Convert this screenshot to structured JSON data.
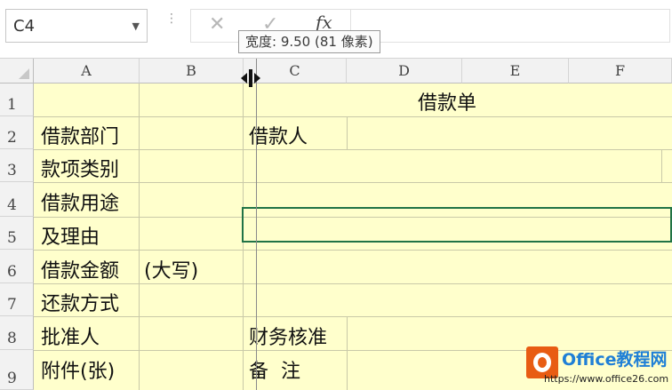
{
  "formula_bar": {
    "name_box": "C4",
    "dropdown_icon": "chevron-down-icon",
    "cancel_icon": "close-icon",
    "enter_icon": "checkmark-icon",
    "fx_label": "fx",
    "formula_value": ""
  },
  "tooltip": {
    "text": "宽度: 9.50 (81 像素)"
  },
  "columns": [
    "A",
    "B",
    "C",
    "D",
    "E",
    "F"
  ],
  "rows": [
    "1",
    "2",
    "3",
    "4",
    "5",
    "6",
    "7",
    "8",
    "9"
  ],
  "cells": {
    "title": "借款单",
    "a2": "借款部门",
    "c2": "借款人",
    "a3": "款项类别",
    "a4": "借款用途",
    "a5": "及理由",
    "a6": "借款金额",
    "b6": "(大写)",
    "a7": "还款方式",
    "a8": "批准人",
    "c8": "财务核准",
    "a9": "附件(张)",
    "c9": "备  注"
  },
  "selected_cell": "C4",
  "colors": {
    "cell_fill": "#ffffcc",
    "selection": "#217346",
    "header": "#f2f2f2"
  },
  "watermark": {
    "name": "Office教程网",
    "url": "https://www.office26.com"
  }
}
